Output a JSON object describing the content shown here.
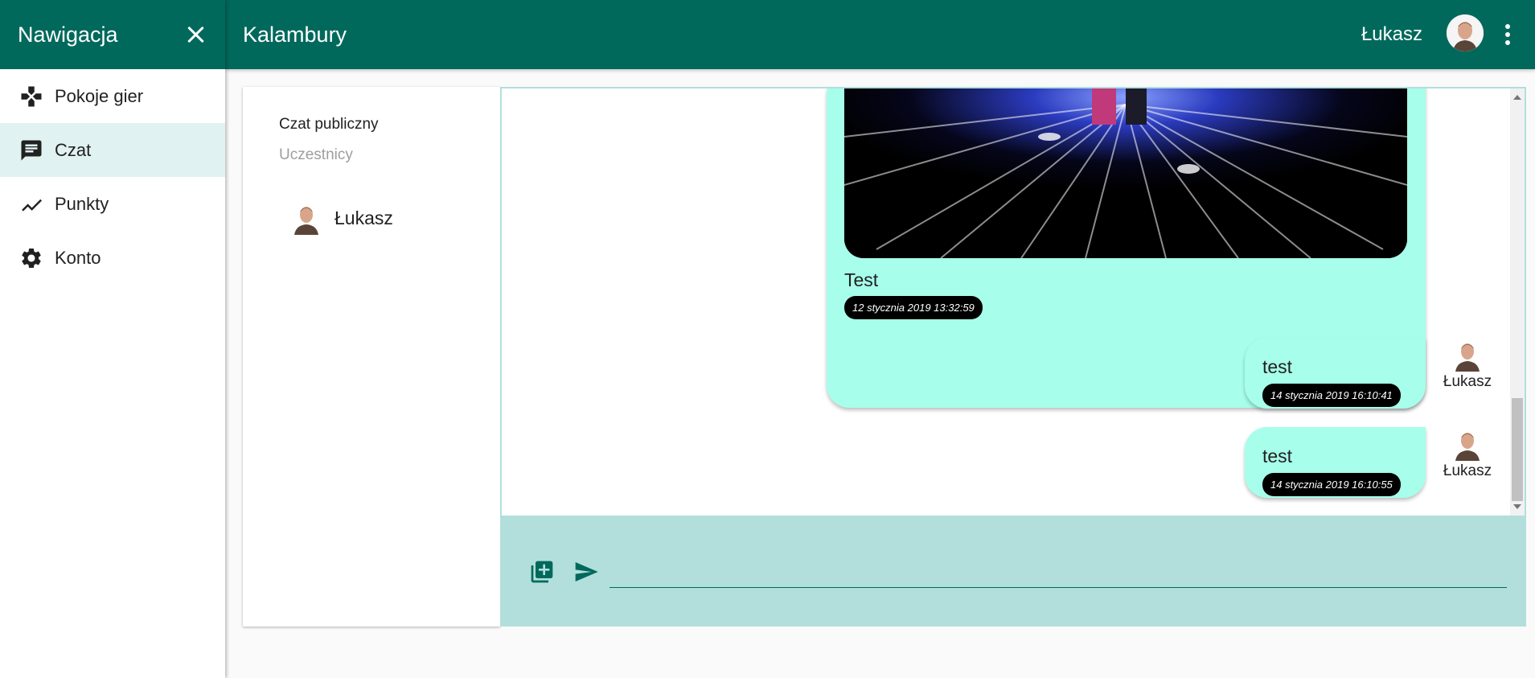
{
  "sidebar": {
    "title": "Nawigacja",
    "items": [
      {
        "label": "Pokoje gier",
        "icon": "gamepad-icon"
      },
      {
        "label": "Czat",
        "icon": "chat-icon",
        "active": true
      },
      {
        "label": "Punkty",
        "icon": "trending-up-icon"
      },
      {
        "label": "Konto",
        "icon": "settings-icon"
      }
    ]
  },
  "topbar": {
    "title": "Kalambury",
    "user_name": "Łukasz"
  },
  "participants_panel": {
    "chat_name": "Czat publiczny",
    "participants_label": "Uczestnicy",
    "participants": [
      {
        "name": "Łukasz"
      }
    ]
  },
  "messages": [
    {
      "type": "image",
      "text": "Test",
      "timestamp": "12 stycznia 2019 13:32:59"
    },
    {
      "type": "text",
      "text": "test",
      "timestamp": "14 stycznia 2019 16:10:41",
      "author": "Łukasz"
    },
    {
      "type": "text",
      "text": "test",
      "timestamp": "14 stycznia 2019 16:10:55",
      "author": "Łukasz"
    }
  ],
  "input": {
    "value": "",
    "placeholder": ""
  },
  "colors": {
    "primary": "#00695c",
    "active_nav": "#e0f2f1",
    "bubble": "#a7ffeb",
    "input_bar": "#b2dfdb",
    "timestamp_bg": "#000000"
  }
}
